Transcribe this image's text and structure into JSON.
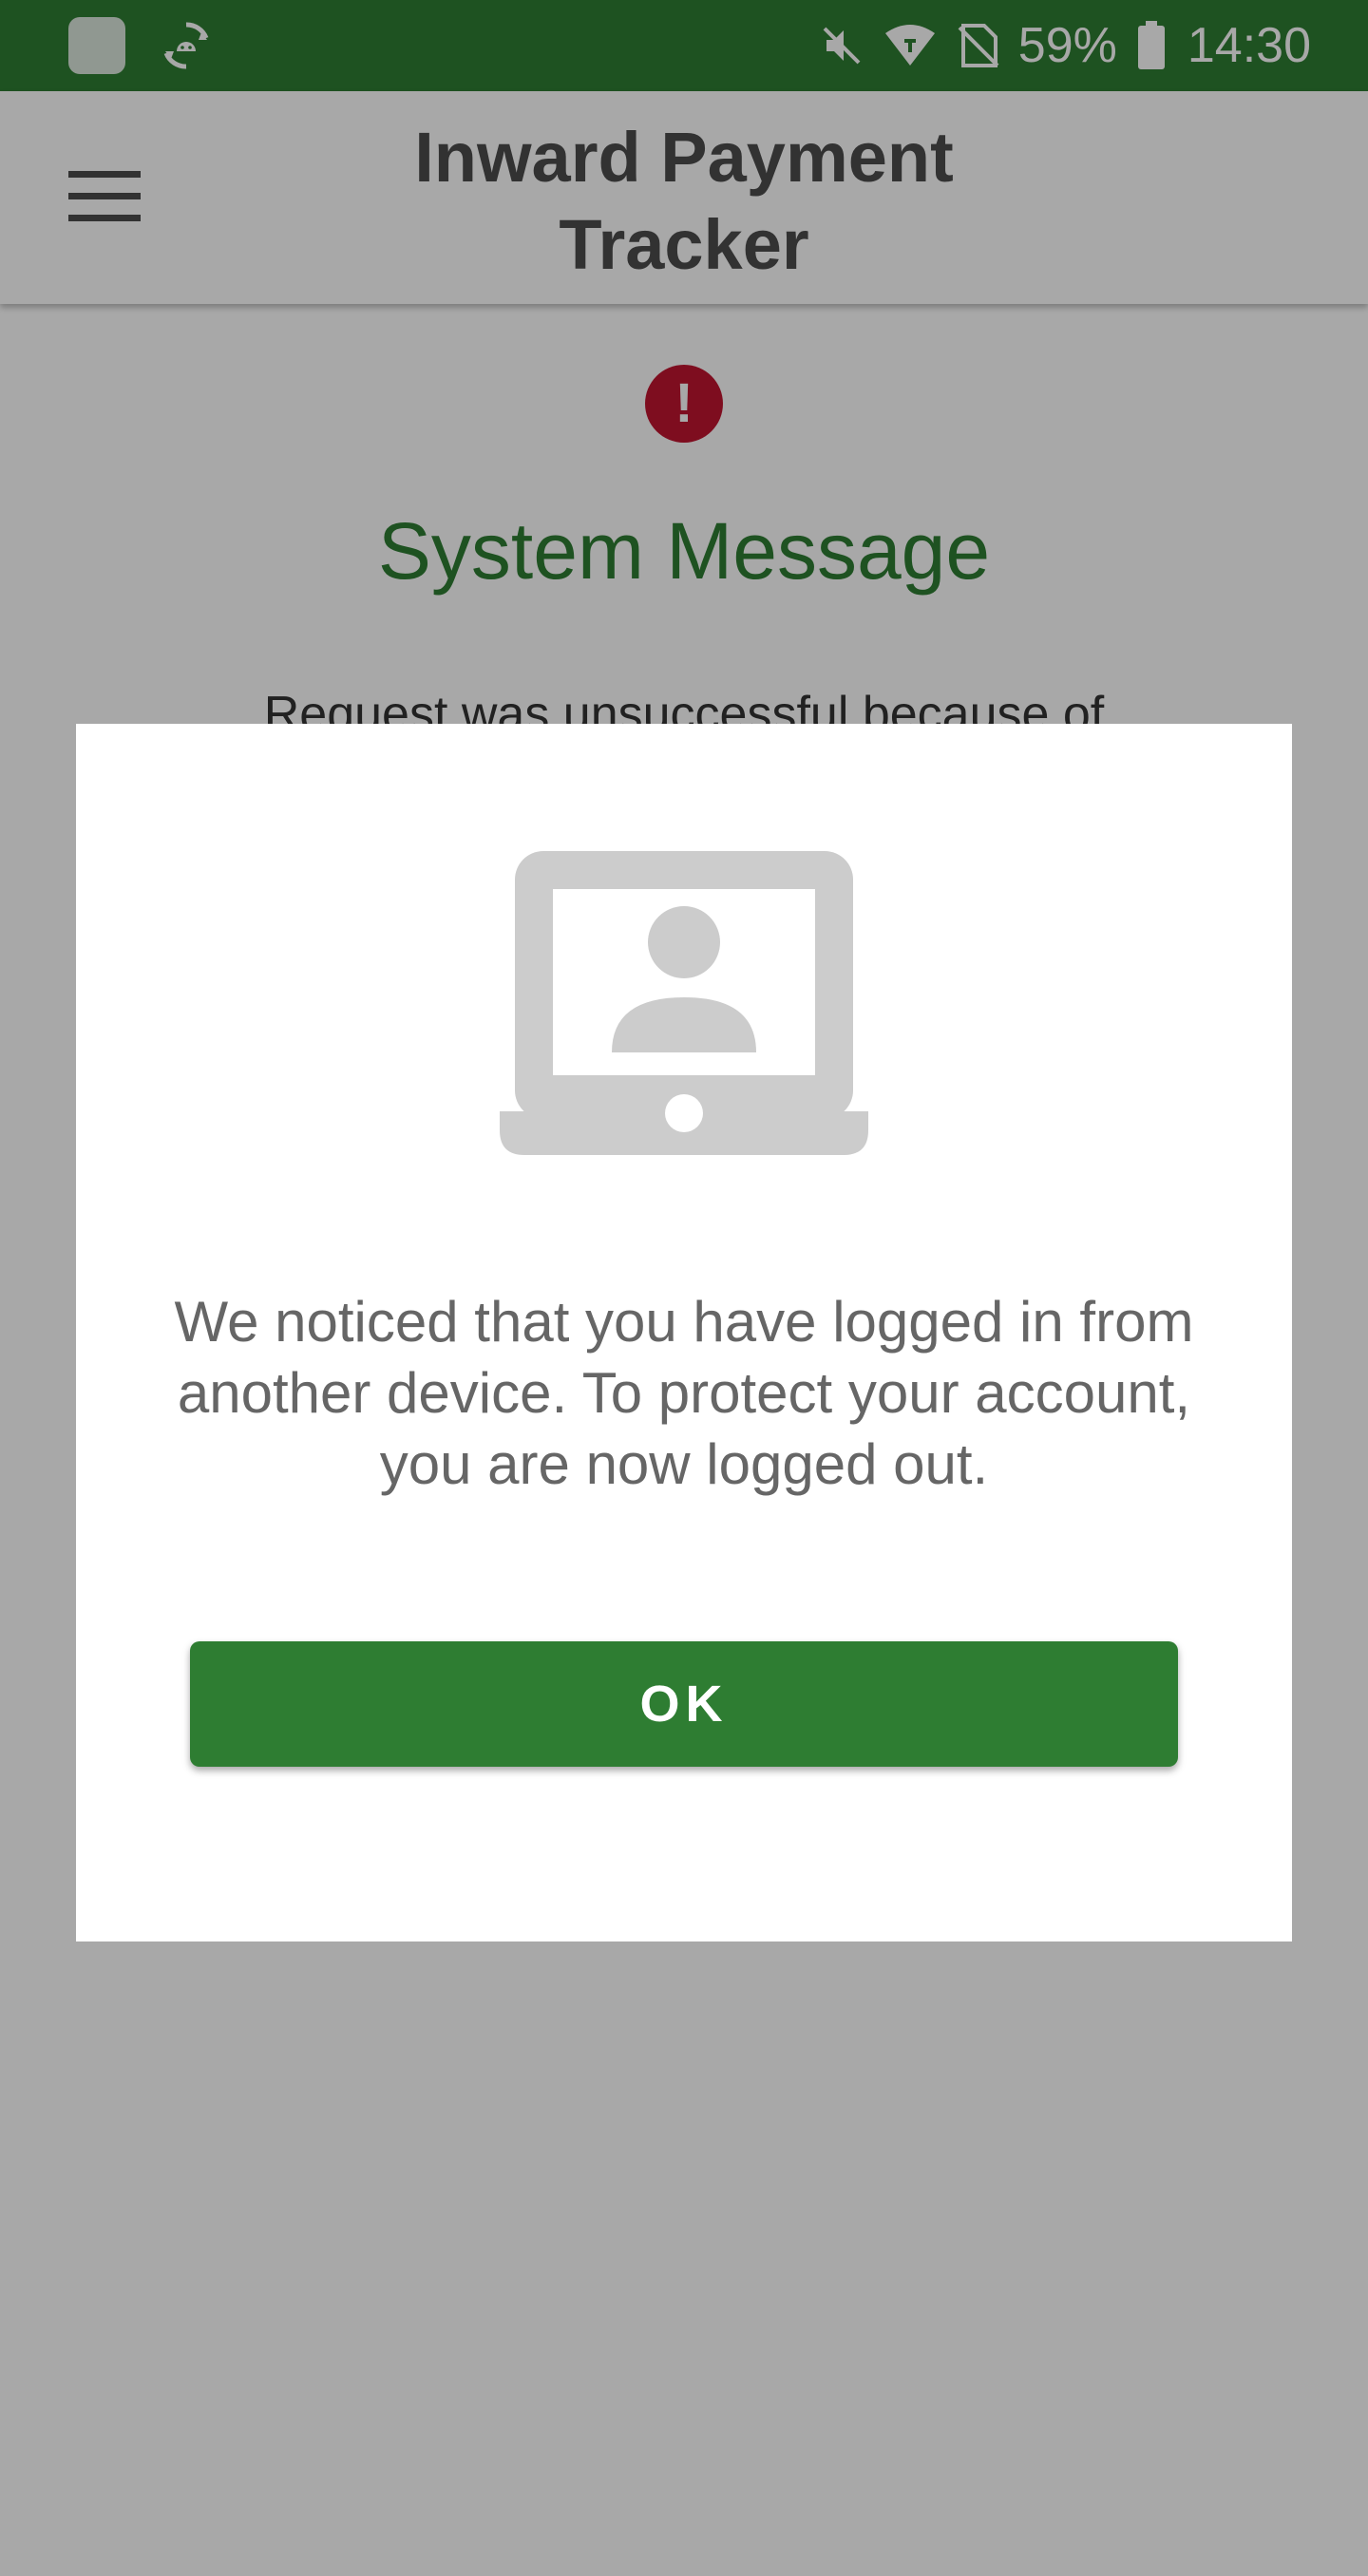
{
  "status_bar": {
    "battery_percent": "59%",
    "time": "14:30",
    "background_color": "#2e7d32",
    "icons": [
      "app-icon",
      "android-sync-icon",
      "mute-icon",
      "wifi-icon",
      "no-sim-icon",
      "battery-icon"
    ]
  },
  "app_bar": {
    "title_line1": "Inward Payment",
    "title_line2": "Tracker",
    "menu_icon": "hamburger-menu-icon"
  },
  "background_page": {
    "icon": "error-icon",
    "icon_glyph": "!",
    "icon_color": "#c0152f",
    "title": "System Message",
    "title_color": "#2e7d32",
    "body": "Request was unsuccessful because of"
  },
  "dialog": {
    "icon": "laptop-user-icon",
    "message": "We noticed that you have logged in from another device. To protect your account, you are now logged out.",
    "ok_label": "OK",
    "button_color": "#2e7d32"
  }
}
